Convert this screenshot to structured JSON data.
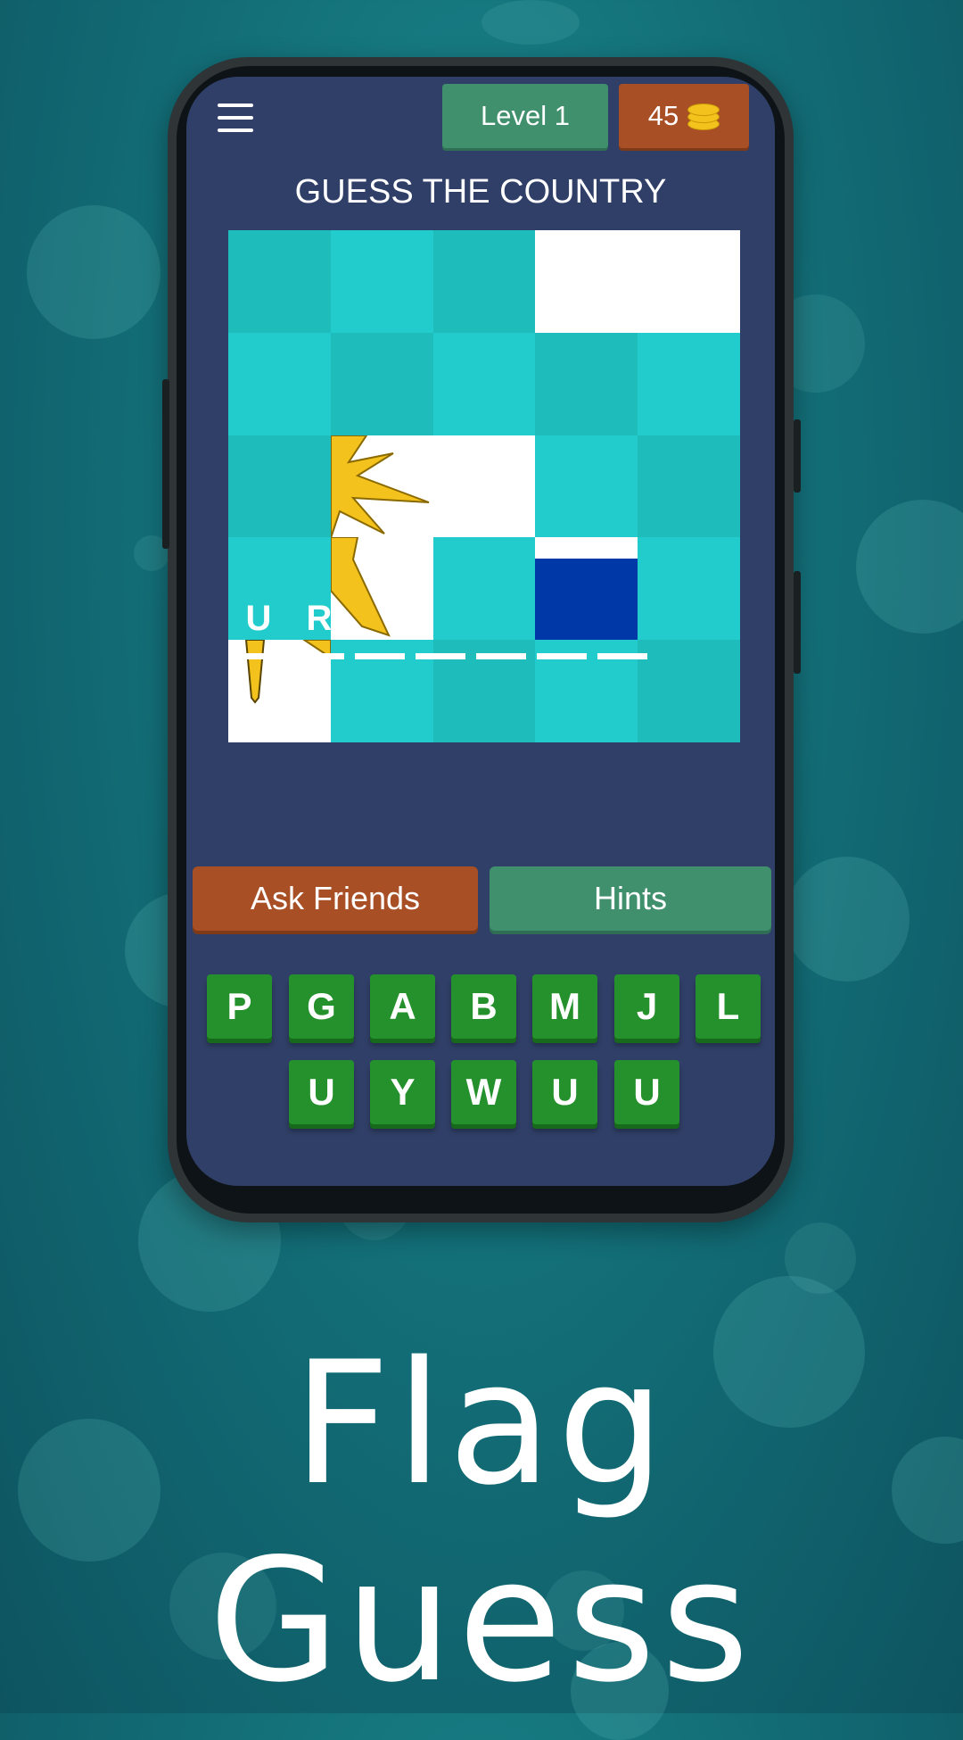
{
  "header": {
    "level_label": "Level 1",
    "coins": "45",
    "menu_icon": "menu-icon",
    "coin_icon": "coins-icon"
  },
  "title": "GUESS THE COUNTRY",
  "answer": {
    "slots": [
      "U",
      "R",
      "",
      "",
      "",
      "",
      ""
    ]
  },
  "buttons": {
    "ask_friends": "Ask Friends",
    "hints": "Hints"
  },
  "keyboard": {
    "row1": [
      "P",
      "G",
      "A",
      "B",
      "M",
      "J",
      "L"
    ],
    "row2": [
      "U",
      "Y",
      "W",
      "U",
      "U"
    ]
  },
  "app_title": "Flag Guess",
  "colors": {
    "screen_bg": "#303f67",
    "level_badge": "#40906e",
    "coins_badge": "#a84f25",
    "key": "#25912c",
    "tile_hidden_a": "#1fbcbc",
    "tile_hidden_b": "#23cccc",
    "flag_blue": "#0038a8",
    "flag_sun": "#fcd116"
  }
}
